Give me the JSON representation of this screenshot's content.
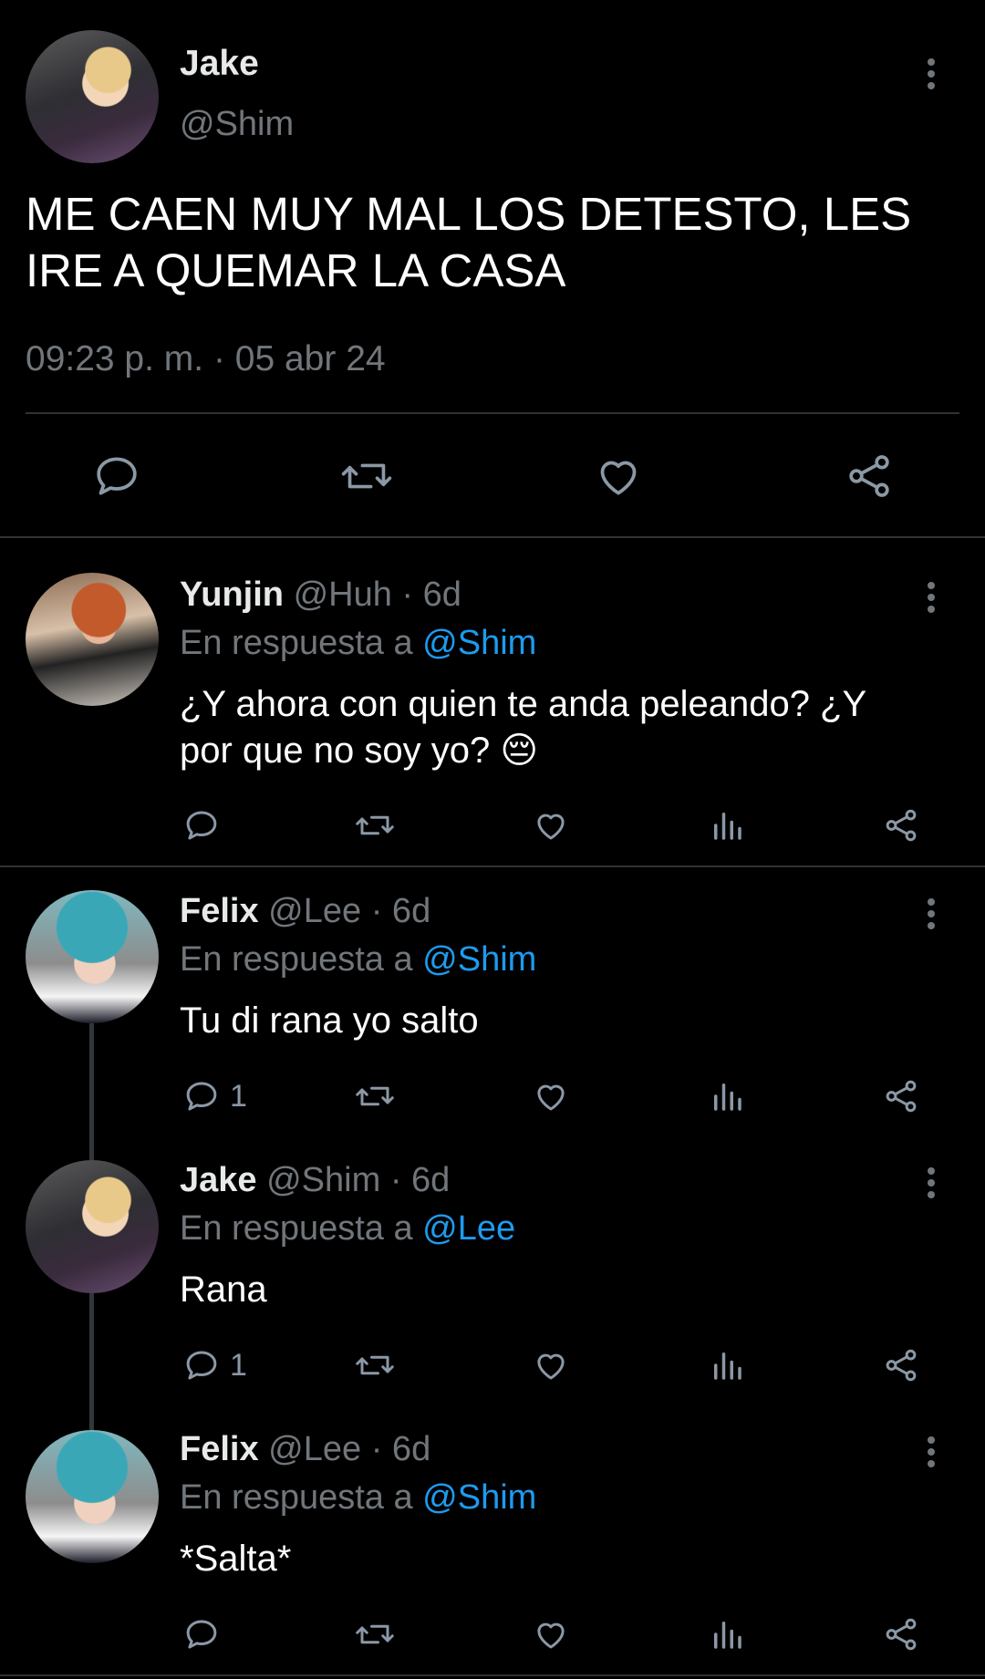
{
  "main_tweet": {
    "name": "Jake",
    "handle": "@Shim",
    "text_line1": "ME CAEN MUY MAL LOS DETESTO, LES",
    "text_line2": "IRE A QUEMAR LA CASA",
    "timestamp": "09:23 p. m. · 05 abr 24"
  },
  "reply_prefix": "En respuesta a",
  "replies": [
    {
      "name": "Yunjin",
      "handle": "@Huh",
      "time": "· 6d",
      "reply_to": "@Shim",
      "line1": "¿Y ahora con quien te anda peleando? ¿Y",
      "line2": "por que no soy yo? 😔",
      "reply_count": ""
    },
    {
      "name": "Felix",
      "handle": "@Lee",
      "time": "· 6d",
      "reply_to": "@Shim",
      "line1": "Tu di rana yo salto",
      "reply_count": "1"
    },
    {
      "name": "Jake",
      "handle": "@Shim",
      "time": "· 6d",
      "reply_to": "@Lee",
      "line1": "Rana",
      "reply_count": "1"
    },
    {
      "name": "Felix",
      "handle": "@Lee",
      "time": "· 6d",
      "reply_to": "@Shim",
      "line1": "*Salta*",
      "reply_count": ""
    }
  ],
  "colors": {
    "background": "#000000",
    "text": "#e7e9ea",
    "muted": "#71767b",
    "link": "#1d9bf0"
  },
  "icons": [
    "reply-icon",
    "retweet-icon",
    "like-icon",
    "share-icon",
    "views-icon",
    "more-icon"
  ]
}
